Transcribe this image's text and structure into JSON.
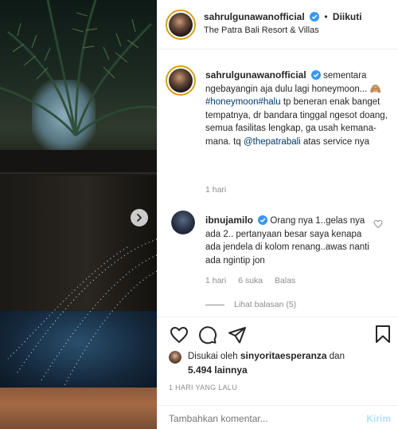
{
  "post": {
    "author": "sahrulgunawanofficial",
    "follow_status": "Diikuti",
    "location": "The Patra Bali Resort & Villas"
  },
  "caption": {
    "author": "sahrulgunawanofficial",
    "text_1": "sementara ngebayangin aja dulu lagi honeymoon...",
    "emoji": "🙈",
    "hashtag_1": "#honeymoon",
    "hashtag_2": "#halu",
    "text_2": "tp beneran enak banget tempatnya, dr bandara tinggal ngesot doang, semua fasilitas lengkap, ga usah kemana-mana. tq",
    "mention": "@thepatrabali",
    "text_3": "atas service nya",
    "time": "1 hari"
  },
  "comment": {
    "author": "ibnujamilo",
    "text": "Orang nya 1..gelas nya ada 2.. pertanyaan besar saya kenapa ada jendela di kolom renang..awas nanti ada ngintip jon",
    "time": "1 hari",
    "likes": "6 suka",
    "reply": "Balas",
    "view_replies": "Lihat balasan (5)"
  },
  "likes": {
    "prefix": "Disukai oleh",
    "user": "sinyoritaesperanza",
    "conjunction": "dan",
    "others": "5.494 lainnya"
  },
  "timestamp": "1 HARI YANG LALU",
  "comment_box": {
    "placeholder": "Tambahkan komentar...",
    "post_label": "Kirim"
  },
  "colors": {
    "verified": "#3897f0",
    "link": "#00376b",
    "muted": "#8e8e8e",
    "post_disabled": "#b2dffc"
  }
}
